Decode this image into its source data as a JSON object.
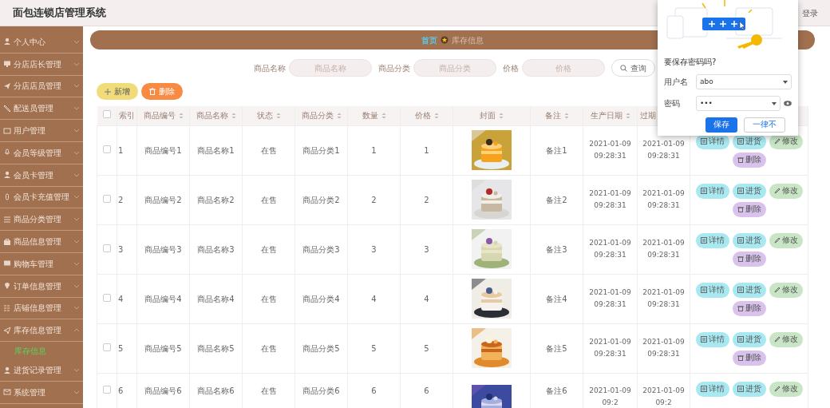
{
  "header": {
    "title": "面包连锁店管理系统",
    "logout": "登录"
  },
  "sidebar": {
    "items": [
      {
        "label": "个人中心",
        "expanded": false
      },
      {
        "label": "分店店长管理",
        "expanded": false
      },
      {
        "label": "分店店员管理",
        "expanded": false
      },
      {
        "label": "配送员管理",
        "expanded": false
      },
      {
        "label": "用户管理",
        "expanded": false
      },
      {
        "label": "会员等级管理",
        "expanded": false
      },
      {
        "label": "会员卡管理",
        "expanded": false
      },
      {
        "label": "会员卡充值管理",
        "expanded": false
      },
      {
        "label": "商品分类管理",
        "expanded": false
      },
      {
        "label": "商品信息管理",
        "expanded": false
      },
      {
        "label": "购物车管理",
        "expanded": false
      },
      {
        "label": "订单信息管理",
        "expanded": false
      },
      {
        "label": "店铺信息管理",
        "expanded": false
      },
      {
        "label": "库存信息管理",
        "expanded": true,
        "children": [
          {
            "label": "库存信息",
            "selected": true
          }
        ]
      },
      {
        "label": "进货记录管理",
        "expanded": false
      },
      {
        "label": "系统管理",
        "expanded": false
      }
    ]
  },
  "breadcrumb": [
    {
      "label": "首页",
      "kind": "link"
    },
    {
      "label": "库存信息",
      "kind": "current"
    }
  ],
  "search": {
    "fields": [
      {
        "label": "商品名称",
        "placeholder": "商品名称"
      },
      {
        "label": "商品分类",
        "placeholder": "商品分类"
      },
      {
        "label": "价格",
        "placeholder": "价格"
      }
    ],
    "button": "查询"
  },
  "toolbar": [
    {
      "label": "新增",
      "kind": "add"
    },
    {
      "label": "删除",
      "kind": "delete"
    }
  ],
  "table": {
    "select_all": {
      "checked": false
    },
    "columns": [
      {
        "label": "索引",
        "sort_icon": false
      },
      {
        "label": "商品编号",
        "sort_icon": true
      },
      {
        "label": "商品名称",
        "sort_icon": true
      },
      {
        "label": "状态",
        "sort_icon": true
      },
      {
        "label": "商品分类",
        "sort_icon": true
      },
      {
        "label": "数量",
        "sort_icon": true
      },
      {
        "label": "价格",
        "sort_icon": true
      },
      {
        "label": "封面",
        "sort_icon": true
      },
      {
        "label": "备注",
        "sort_icon": true
      },
      {
        "label": "生产日期",
        "sort_icon": true
      },
      {
        "label": "过期",
        "sort_icon": false
      }
    ],
    "rows": [
      {
        "checked": false,
        "cells": [
          "1",
          "商品编号1",
          "商品名称1",
          "在售",
          "商品分类1",
          "1",
          "1",
          {
            "kind": "picture"
          },
          "备注1",
          "2021-01-09 09:28:31",
          "2021-01-09 09:28:31"
        ],
        "actions": [
          {
            "label": "详情",
            "kind": "detail"
          },
          {
            "label": "进货",
            "kind": "stock"
          },
          {
            "label": "修改",
            "kind": "edit"
          },
          {
            "label": "删除",
            "kind": "delete"
          }
        ]
      },
      {
        "checked": false,
        "cells": [
          "2",
          "商品编号2",
          "商品名称2",
          "在售",
          "商品分类2",
          "2",
          "2",
          {
            "kind": "picture"
          },
          "备注2",
          "2021-01-09 09:28:31",
          "2021-01-09 09:28:31"
        ],
        "actions": [
          {
            "label": "详情",
            "kind": "detail"
          },
          {
            "label": "进货",
            "kind": "stock"
          },
          {
            "label": "修改",
            "kind": "edit"
          },
          {
            "label": "删除",
            "kind": "delete"
          }
        ]
      },
      {
        "checked": false,
        "cells": [
          "3",
          "商品编号3",
          "商品名称3",
          "在售",
          "商品分类3",
          "3",
          "3",
          {
            "kind": "picture"
          },
          "备注3",
          "2021-01-09 09:28:31",
          "2021-01-09 09:28:31"
        ],
        "actions": [
          {
            "label": "详情",
            "kind": "detail"
          },
          {
            "label": "进货",
            "kind": "stock"
          },
          {
            "label": "修改",
            "kind": "edit"
          },
          {
            "label": "删除",
            "kind": "delete"
          }
        ]
      },
      {
        "checked": false,
        "cells": [
          "4",
          "商品编号4",
          "商品名称4",
          "在售",
          "商品分类4",
          "4",
          "4",
          {
            "kind": "picture"
          },
          "备注4",
          "2021-01-09 09:28:31",
          "2021-01-09 09:28:31"
        ],
        "actions": [
          {
            "label": "详情",
            "kind": "detail"
          },
          {
            "label": "进货",
            "kind": "stock"
          },
          {
            "label": "修改",
            "kind": "edit"
          },
          {
            "label": "删除",
            "kind": "delete"
          }
        ]
      },
      {
        "checked": false,
        "cells": [
          "5",
          "商品编号5",
          "商品名称5",
          "在售",
          "商品分类5",
          "5",
          "5",
          {
            "kind": "picture"
          },
          "备注5",
          "2021-01-09 09:28:31",
          "2021-01-09 09:28:31"
        ],
        "actions": [
          {
            "label": "详情",
            "kind": "detail"
          },
          {
            "label": "进货",
            "kind": "stock"
          },
          {
            "label": "修改",
            "kind": "edit"
          },
          {
            "label": "删除",
            "kind": "delete"
          }
        ]
      },
      {
        "checked": false,
        "cells": [
          "6",
          "商品编号6",
          "商品名称6",
          "在售",
          "商品分类6",
          "6",
          "6",
          {
            "kind": "picture"
          },
          "备注6",
          "2021-01-09 09:2",
          "2021-01-09 09:2"
        ],
        "actions": [
          {
            "label": "详情",
            "kind": "detail"
          },
          {
            "label": "进货",
            "kind": "stock"
          },
          {
            "label": "修改",
            "kind": "edit"
          }
        ]
      }
    ]
  },
  "password_prompt": {
    "title": "要保存密码吗?",
    "username_label": "用户名",
    "username": "abo",
    "password_label": "密码",
    "password": "•••",
    "save": "保存",
    "never": "一律不"
  }
}
